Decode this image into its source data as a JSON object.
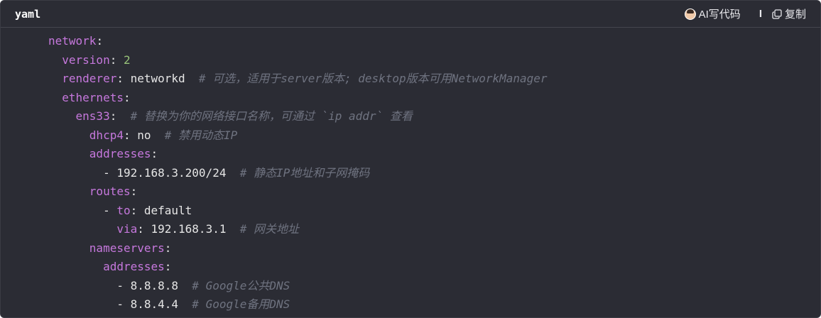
{
  "header": {
    "language": "yaml",
    "ai_label": "AI写代码",
    "separator": "I",
    "copy_label": "复制"
  },
  "code_lines": [
    {
      "indent": "",
      "key": "network",
      "colon": ":",
      "value": "",
      "comment": ""
    },
    {
      "indent": "  ",
      "key": "version",
      "colon": ": ",
      "value": "2",
      "comment": "",
      "value_type": "number"
    },
    {
      "indent": "  ",
      "key": "renderer",
      "colon": ": ",
      "value": "networkd",
      "comment": "  # 可选，适用于server版本; desktop版本可用NetworkManager"
    },
    {
      "indent": "  ",
      "key": "ethernets",
      "colon": ":",
      "value": "",
      "comment": ""
    },
    {
      "indent": "    ",
      "key": "ens33",
      "colon": ":",
      "value": "",
      "comment": "  # 替换为你的网络接口名称，可通过 `ip addr` 查看"
    },
    {
      "indent": "      ",
      "key": "dhcp4",
      "colon": ": ",
      "value": "no",
      "comment": "  # 禁用动态IP"
    },
    {
      "indent": "      ",
      "key": "addresses",
      "colon": ":",
      "value": "",
      "comment": ""
    },
    {
      "indent": "        ",
      "key": "",
      "colon": "",
      "value": "- 192.168.3.200/24",
      "comment": "  # 静态IP地址和子网掩码"
    },
    {
      "indent": "      ",
      "key": "routes",
      "colon": ":",
      "value": "",
      "comment": ""
    },
    {
      "indent": "        ",
      "dash": "- ",
      "key": "to",
      "colon": ": ",
      "value": "default",
      "comment": ""
    },
    {
      "indent": "          ",
      "key": "via",
      "colon": ": ",
      "value": "192.168.3.1",
      "comment": "  # 网关地址"
    },
    {
      "indent": "      ",
      "key": "nameservers",
      "colon": ":",
      "value": "",
      "comment": ""
    },
    {
      "indent": "        ",
      "key": "addresses",
      "colon": ":",
      "value": "",
      "comment": ""
    },
    {
      "indent": "          ",
      "key": "",
      "colon": "",
      "value": "- 8.8.8.8",
      "comment": "  # Google公共DNS"
    },
    {
      "indent": "          ",
      "key": "",
      "colon": "",
      "value": "- 8.8.4.4",
      "comment": "  # Google备用DNS"
    }
  ],
  "colors": {
    "background": "#2b2c34",
    "key": "#c678dd",
    "number": "#98c379",
    "comment": "#6f7380",
    "text": "#e6e6e6"
  }
}
